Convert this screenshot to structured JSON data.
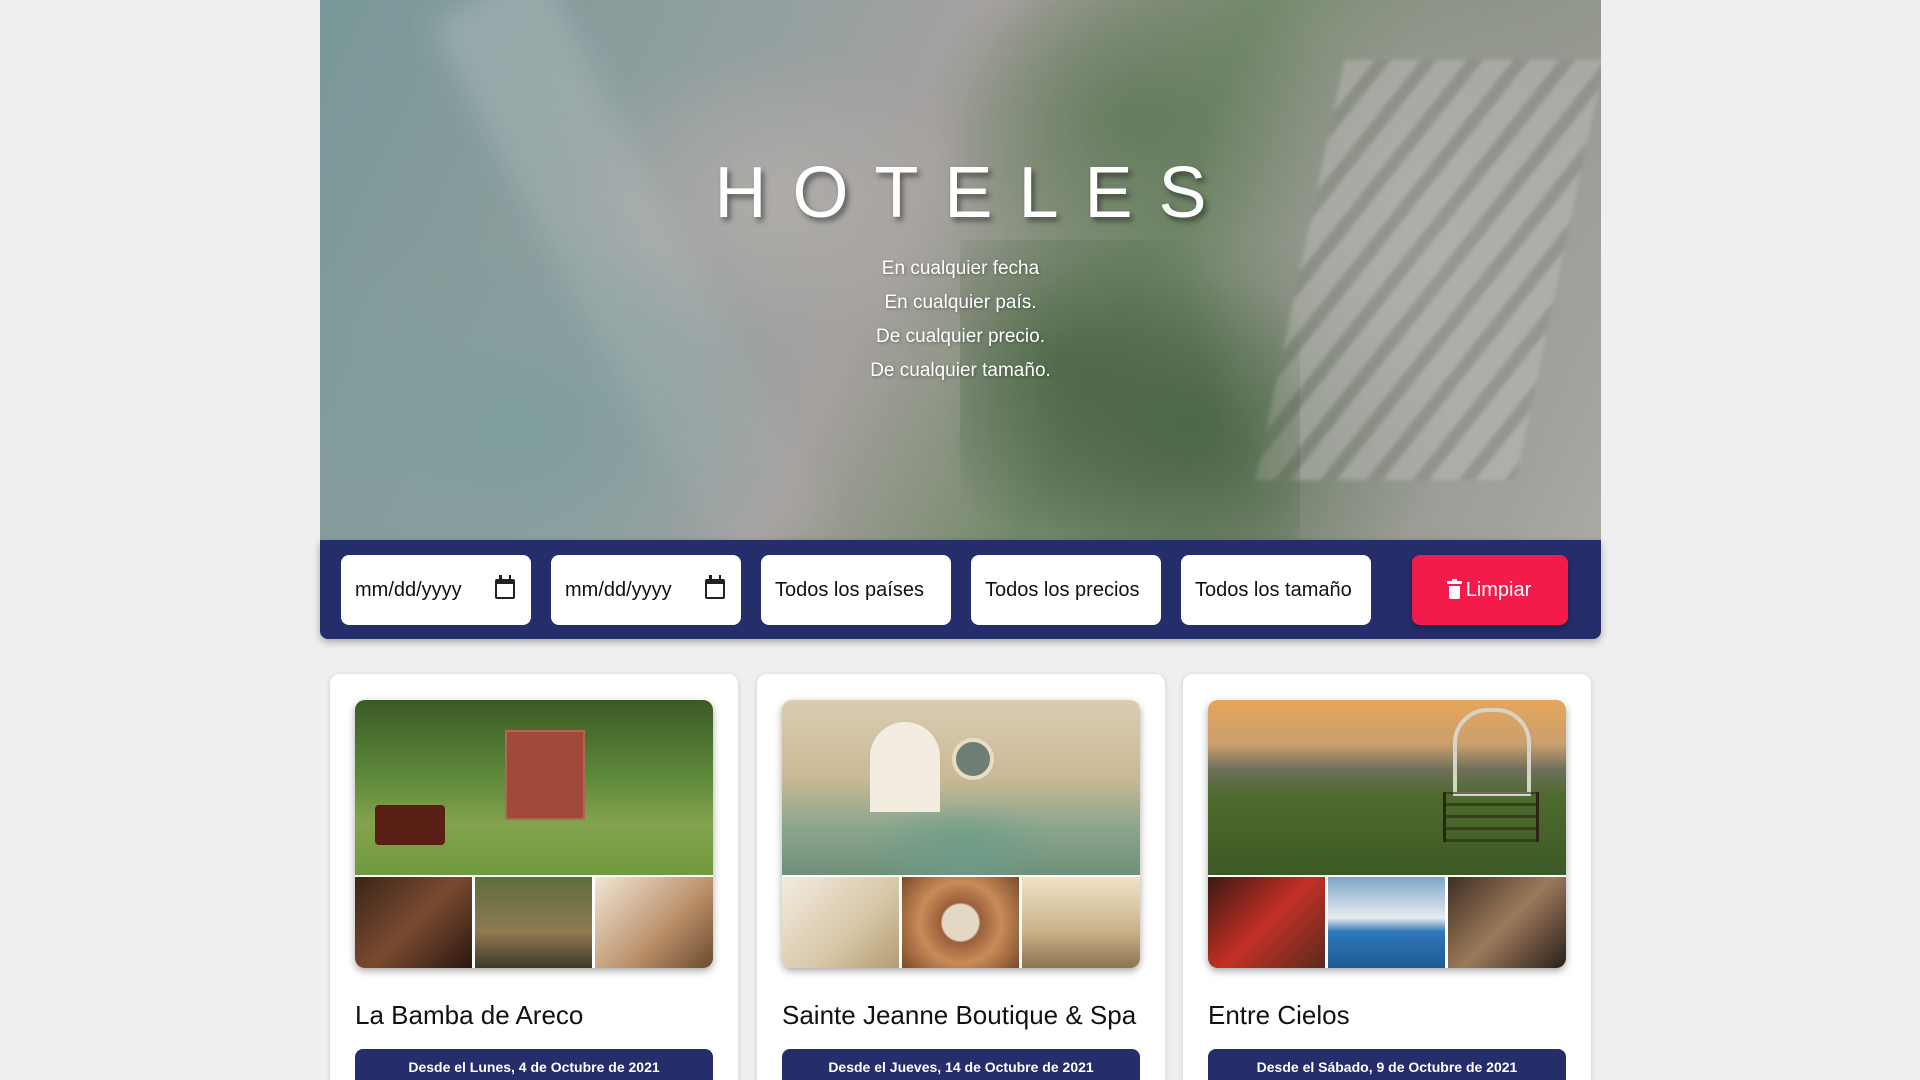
{
  "hero": {
    "title": "HOTELES",
    "taglines": [
      "En cualquier fecha",
      "En cualquier país.",
      "De cualquier precio.",
      "De cualquier tamaño."
    ]
  },
  "filters": {
    "date_from_placeholder": "mm/dd/yyyy",
    "date_to_placeholder": "mm/dd/yyyy",
    "country": "Todos los países",
    "price": "Todos los precios",
    "size": "Todos los tamaño",
    "clear_label": "Limpiar"
  },
  "colors": {
    "bar": "#252d6b",
    "clear_button": "#f31b49",
    "background": "#efefef"
  },
  "hotels": [
    {
      "name": "La Bamba de Areco",
      "availability": "Desde el Lunes, 4 de Octubre de 2021"
    },
    {
      "name": "Sainte Jeanne Boutique & Spa",
      "availability": "Desde el Jueves, 14 de Octubre de 2021"
    },
    {
      "name": "Entre Cielos",
      "availability": "Desde el Sábado, 9 de Octubre de 2021"
    }
  ]
}
